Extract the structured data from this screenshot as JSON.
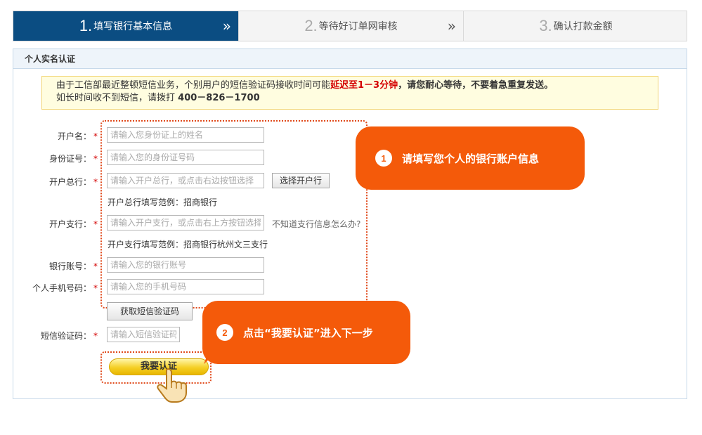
{
  "steps": [
    {
      "num": "1.",
      "label": "填写银行基本信息"
    },
    {
      "num": "2.",
      "label": "等待好订单网审核"
    },
    {
      "num": "3.",
      "label": "确认打款金额"
    }
  ],
  "step_chevron": "»",
  "panel": {
    "title": "个人实名认证"
  },
  "notice": {
    "line1_a": "由于工信部最近整顿短信业务，个别用户的短信验证码接收时间可能",
    "line1_warn": "延迟至1－3分钟",
    "line1_b": "，请您耐心等待，不要着急重复发送。",
    "line2_a": "如长时间收不到短信，请拨打",
    "line2_phone": "400－826－1700"
  },
  "form": {
    "required_mark": "*",
    "name": {
      "label": "开户名：",
      "placeholder": "请输入您身份证上的姓名"
    },
    "id_number": {
      "label": "身份证号：",
      "placeholder": "请输入您的身份证号码"
    },
    "bank": {
      "label": "开户总行：",
      "placeholder": "请输入开户总行，或点击右边按钮选择",
      "button": "选择开户行",
      "example": "开户总行填写范例：招商银行"
    },
    "branch": {
      "label": "开户支行：",
      "placeholder": "请输入开户支行，或点击右上方按钮选择",
      "help": "不知道支行信息怎么办?",
      "example": "开户支行填写范例：招商银行杭州文三支行"
    },
    "account": {
      "label": "银行账号：",
      "placeholder": "请输入您的银行账号"
    },
    "phone": {
      "label": "个人手机号码：",
      "placeholder": "请输入您的手机号码"
    },
    "get_code_button": "获取短信验证码",
    "sms_code": {
      "label": "短信验证码：",
      "placeholder": "请输入短信验证码"
    },
    "submit": "我要认证"
  },
  "callouts": [
    {
      "num": "1",
      "text": "请填写您个人的银行账户信息"
    },
    {
      "num": "2",
      "text": "点击“我要认证”进入下一步"
    }
  ],
  "colors": {
    "active_step": "#0b4d82",
    "callout": "#f45a0a",
    "required": "#d40000"
  }
}
